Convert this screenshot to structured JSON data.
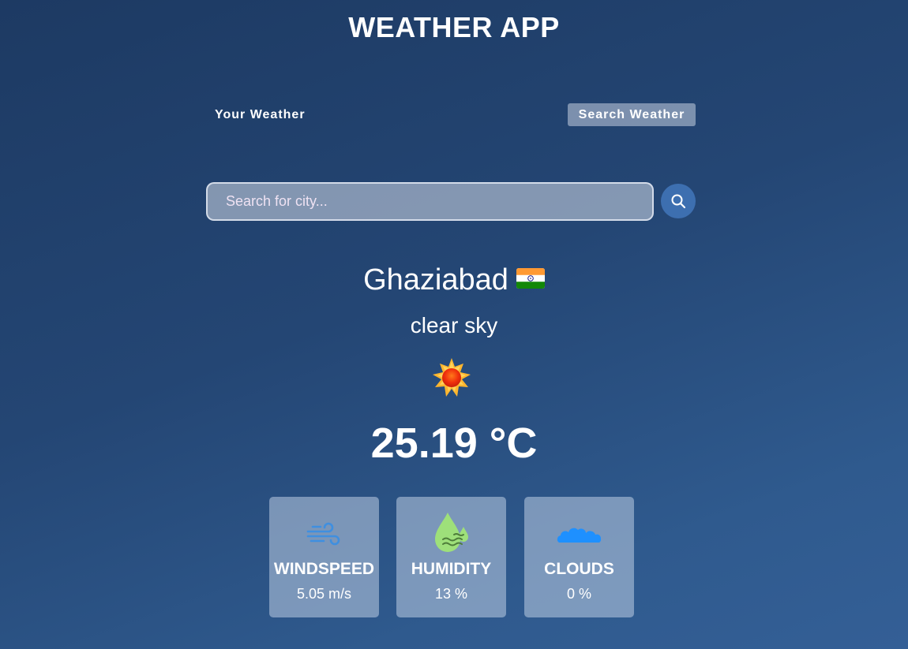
{
  "app": {
    "title": "WEATHER APP"
  },
  "tabs": [
    {
      "label": "Your Weather",
      "active": false
    },
    {
      "label": "Search Weather",
      "active": true
    }
  ],
  "search": {
    "placeholder": "Search for city...",
    "value": "",
    "button_icon": "search-icon"
  },
  "weather": {
    "city": "Ghaziabad",
    "country_flag": "india-flag",
    "description": "clear sky",
    "icon": "sun-icon",
    "temperature": "25.19 °C"
  },
  "stats": [
    {
      "label": "WINDSPEED",
      "value": "5.05 m/s",
      "icon": "wind-icon"
    },
    {
      "label": "HUMIDITY",
      "value": "13 %",
      "icon": "humidity-icon"
    },
    {
      "label": "CLOUDS",
      "value": "0 %",
      "icon": "cloud-icon"
    }
  ],
  "colors": {
    "background_top": "#1d3a63",
    "background_bottom": "#345f96",
    "search_button": "#3d6fb0",
    "wind_icon": "#3f8fe0",
    "humidity_icon": "#9ee07a",
    "cloud_icon": "#1e90ff"
  }
}
